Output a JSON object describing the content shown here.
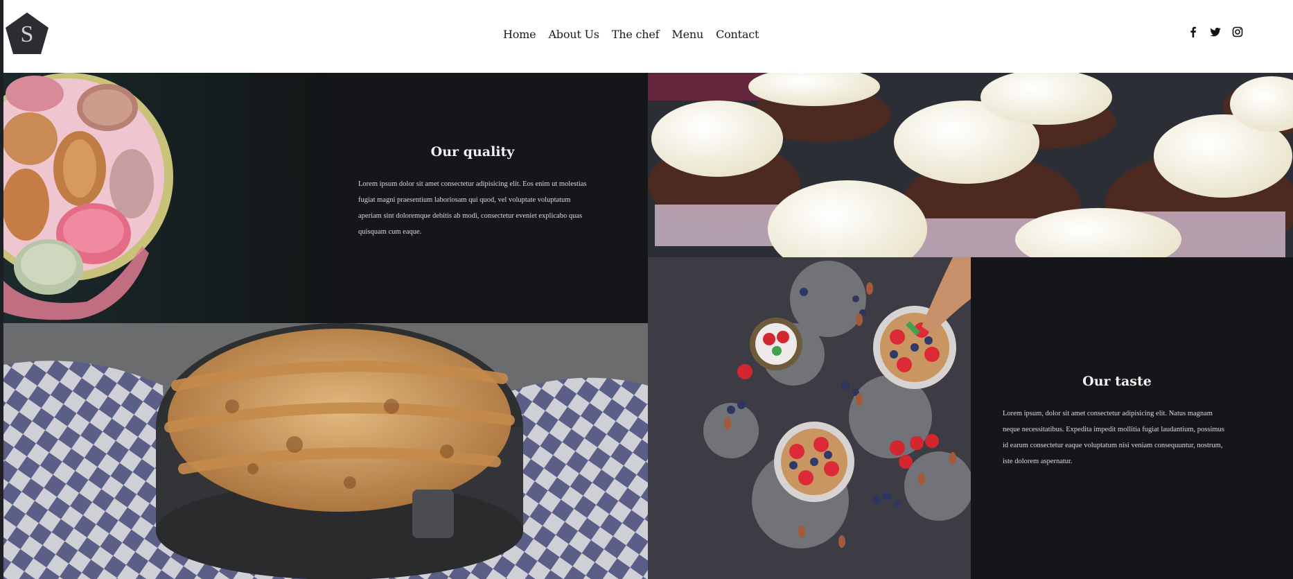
{
  "brand": {
    "logo_letter": "S"
  },
  "nav": {
    "items": [
      "Home",
      "About Us",
      "The chef",
      "Menu",
      "Contact"
    ]
  },
  "social": {
    "icons": [
      "facebook-icon",
      "twitter-icon",
      "instagram-icon"
    ]
  },
  "sections": {
    "quality": {
      "title": "Our quality",
      "body": "Lorem ipsum dolor sit amet consectetur adipisicing elit. Eos enim ut molestias fugiat magni praesentium laboriosam qui quod, vel voluptate voluptatum aperiam sint doloremque debitis ab modi, consectetur eveniet explicabo quas quisquam cum eaque."
    },
    "taste": {
      "title": "Our taste",
      "body": "Lorem ipsum, dolor sit amet consectetur adipisicing elit. Natus magnam neque necessitatibus. Expedita impedit mollitia fugiat laudantium, possimus id earum consectetur eaque voluptatum nisi veniam consequuntur, nostrum, iste dolorem aspernatur."
    }
  },
  "colors": {
    "panel_dark": "#141619",
    "logo_bg": "#2b2d31",
    "text_light": "#e6e6e6"
  }
}
